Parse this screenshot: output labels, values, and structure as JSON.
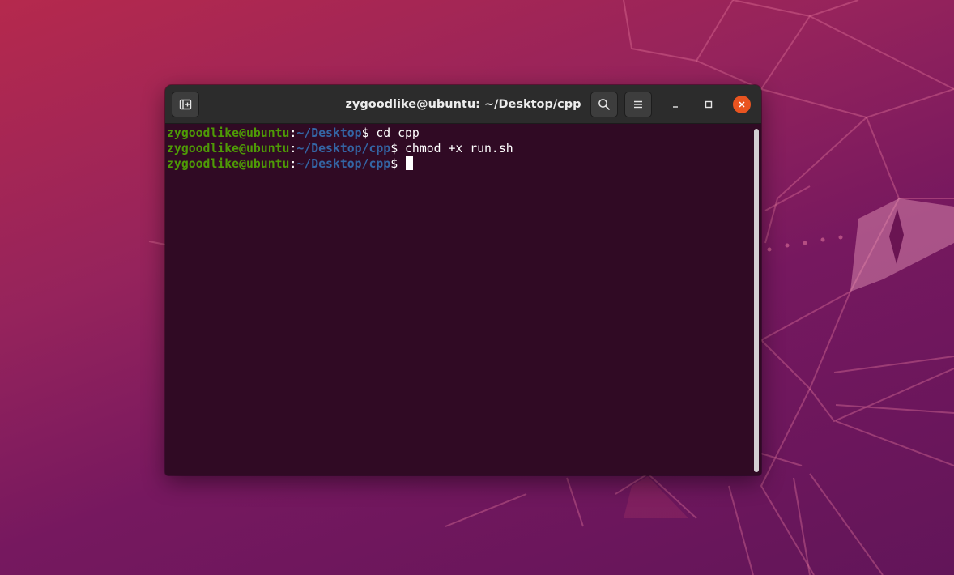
{
  "window": {
    "title": "zygoodlike@ubuntu: ~/Desktop/cpp",
    "buttons": {
      "new_tab_icon": "new-tab-icon",
      "search_icon": "search-icon",
      "menu_icon": "hamburger-menu-icon",
      "minimize_icon": "minimize-icon",
      "maximize_icon": "maximize-icon",
      "close_icon": "close-icon"
    },
    "close_color": "#e95420"
  },
  "terminal": {
    "colors": {
      "background": "#300a24",
      "user": "#4e9a06",
      "path": "#3465a4",
      "text": "#ffffff"
    },
    "lines": [
      {
        "user": "zygoodlike@ubuntu",
        "sep": ":",
        "path": "~/Desktop",
        "prompt": "$ ",
        "command": "cd cpp"
      },
      {
        "user": "zygoodlike@ubuntu",
        "sep": ":",
        "path": "~/Desktop/cpp",
        "prompt": "$ ",
        "command": "chmod +x run.sh"
      },
      {
        "user": "zygoodlike@ubuntu",
        "sep": ":",
        "path": "~/Desktop/cpp",
        "prompt": "$ ",
        "command": ""
      }
    ]
  }
}
